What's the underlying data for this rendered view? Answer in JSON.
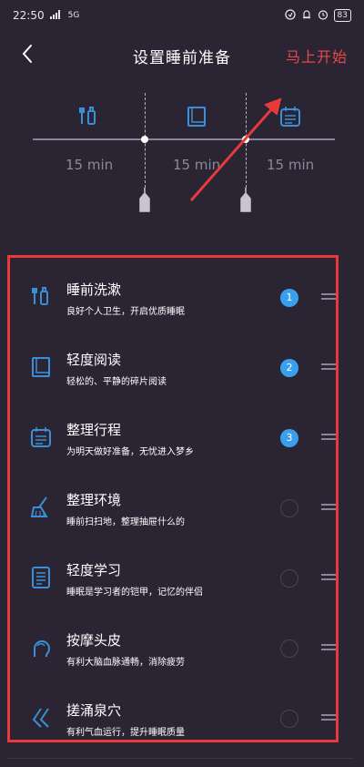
{
  "status": {
    "time": "22:50",
    "network": "5G",
    "battery": "83"
  },
  "nav": {
    "title": "设置睡前准备",
    "start_label": "马上开始"
  },
  "timeline": {
    "segments": [
      {
        "icon": "toothbrush-icon",
        "duration": "15 min"
      },
      {
        "icon": "book-icon",
        "duration": "15 min"
      },
      {
        "icon": "calendar-icon",
        "duration": "15 min"
      }
    ]
  },
  "activities": [
    {
      "title": "睡前洗漱",
      "desc": "良好个人卫生，开启优质睡眠",
      "icon": "toothbrush-icon",
      "order": "1"
    },
    {
      "title": "轻度阅读",
      "desc": "轻松的、平静的碎片阅读",
      "icon": "book-icon",
      "order": "2"
    },
    {
      "title": "整理行程",
      "desc": "为明天做好准备，无忧进入梦乡",
      "icon": "calendar-icon",
      "order": "3"
    },
    {
      "title": "整理环境",
      "desc": "睡前扫扫地，整理抽屉什么的",
      "icon": "broom-icon",
      "order": ""
    },
    {
      "title": "轻度学习",
      "desc": "睡眠是学习者的铠甲，记忆的伴侣",
      "icon": "notebook-icon",
      "order": ""
    },
    {
      "title": "按摩头皮",
      "desc": "有利大脑血脉通畅，消除疲劳",
      "icon": "head-massage-icon",
      "order": ""
    },
    {
      "title": "搓涌泉穴",
      "desc": "有利气血运行，提升睡眠质量",
      "icon": "foot-icon",
      "order": ""
    }
  ],
  "colors": {
    "background": "#2a2433",
    "accent_red": "#e84a4a",
    "badge_blue": "#3aa0ee",
    "icon_blue": "#3a8fd6"
  }
}
